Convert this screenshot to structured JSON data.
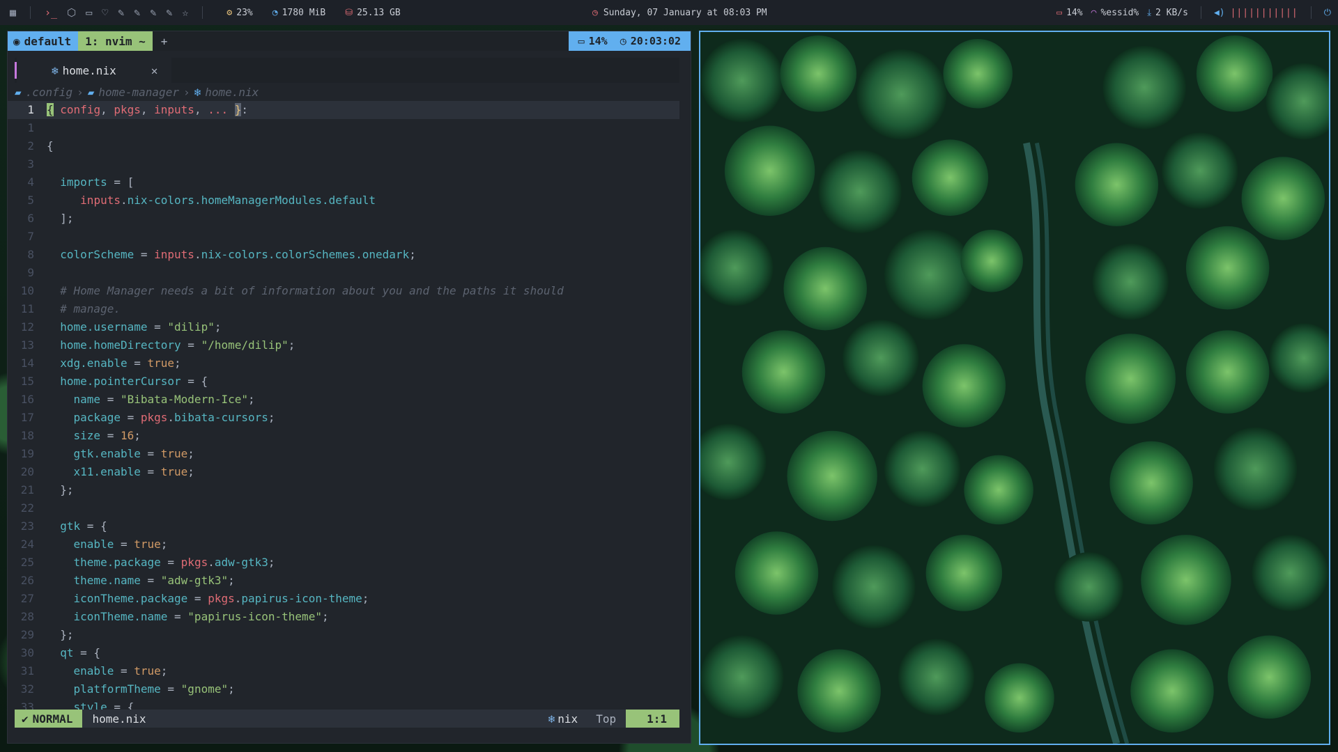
{
  "topbar": {
    "left_icons": [
      "grid-icon",
      "terminal-icon",
      "browser-icon",
      "folder-icon",
      "heart-icon",
      "edit-icon",
      "edit-icon",
      "edit-icon",
      "edit-icon",
      "star-icon"
    ],
    "cpu": "23%",
    "memory": "1780 MiB",
    "disk": "25.13 GB",
    "datetime": "Sunday, 07 January at 08:03 PM",
    "battery": "14%",
    "wifi": "%essid%",
    "download": "2 KB/s",
    "volume_bars": "|||||||||||"
  },
  "tmux": {
    "session": "default",
    "window": "1: nvim ~",
    "plus": "+",
    "battery": "14%",
    "clock": "20:03:02"
  },
  "buffer": {
    "filename": "home.nix",
    "close": "✕"
  },
  "breadcrumbs": {
    "dir1": ".config",
    "dir2": "home-manager",
    "file": "home.nix"
  },
  "statusline": {
    "mode": "NORMAL",
    "file": "home.nix",
    "filetype": "nix",
    "position": "Top",
    "line_col": "1:1"
  },
  "colors": {
    "accent_blue": "#61afef",
    "accent_green": "#98c379",
    "accent_purple": "#c678dd",
    "accent_red": "#e06c75"
  }
}
